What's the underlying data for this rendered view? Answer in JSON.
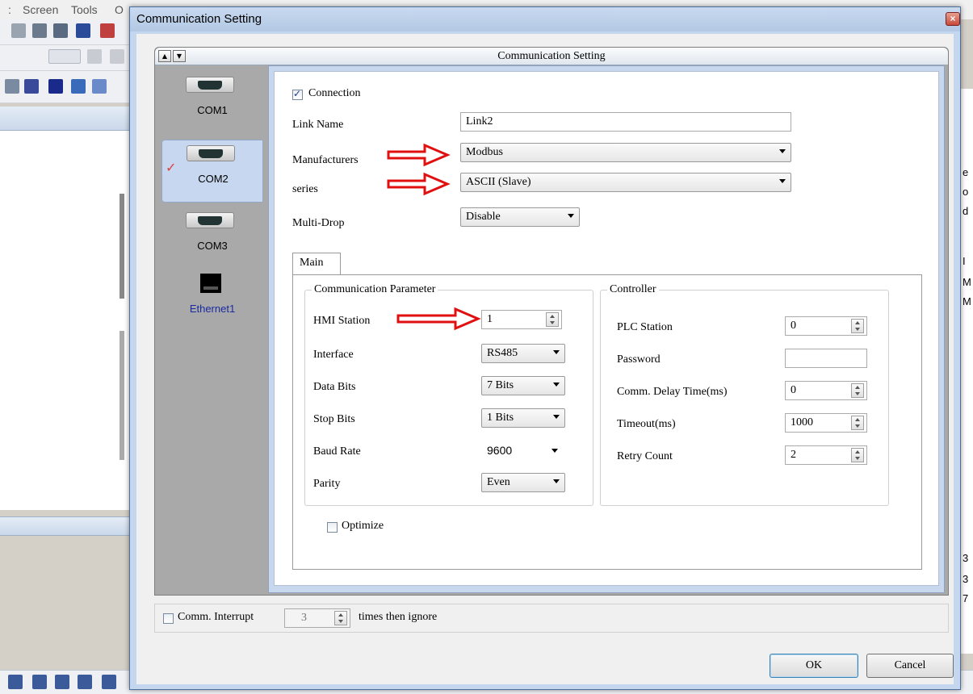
{
  "bg_app": {
    "menu_screen": "Screen",
    "menu_tools": "Tools",
    "menu_cut": "O",
    "menu_dot": ":",
    "right_strip_chars": [
      "e",
      "o",
      "d",
      "I",
      "M",
      "M",
      "3",
      "3",
      "7"
    ]
  },
  "dialog": {
    "title": "Communication Setting",
    "close_glyph": "×",
    "header_title": "Communication Setting",
    "up_glyph": "▲",
    "down_glyph": "▼"
  },
  "ports": [
    {
      "label": "COM1",
      "selected": false
    },
    {
      "label": "COM2",
      "selected": true
    },
    {
      "label": "COM3",
      "selected": false
    },
    {
      "label": "Ethernet1",
      "selected": false
    }
  ],
  "form": {
    "connection_label": "Connection",
    "connection_checked": true,
    "link_name_label": "Link Name",
    "link_name_value": "Link2",
    "manufacturers_label": "Manufacturers",
    "manufacturers_value": "Modbus",
    "series_label": "series",
    "series_value": "ASCII (Slave)",
    "multidrop_label": "Multi-Drop",
    "multidrop_value": "Disable"
  },
  "tab": {
    "main_label": "Main"
  },
  "comm_param": {
    "title": "Communication Parameter",
    "hmi_station_label": "HMI Station",
    "hmi_station_value": "1",
    "interface_label": "Interface",
    "interface_value": "RS485",
    "data_bits_label": "Data Bits",
    "data_bits_value": "7 Bits",
    "stop_bits_label": "Stop Bits",
    "stop_bits_value": "1 Bits",
    "baud_rate_label": "Baud Rate",
    "baud_rate_value": "9600",
    "parity_label": "Parity",
    "parity_value": "Even"
  },
  "controller": {
    "title": "Controller",
    "plc_station_label": "PLC Station",
    "plc_station_value": "0",
    "password_label": "Password",
    "password_value": "",
    "delay_label": "Comm. Delay Time(ms)",
    "delay_value": "0",
    "timeout_label": "Timeout(ms)",
    "timeout_value": "1000",
    "retry_label": "Retry Count",
    "retry_value": "2"
  },
  "optimize_label": "Optimize",
  "interrupt": {
    "label": "Comm. Interrupt",
    "value": "3",
    "suffix": "times then ignore"
  },
  "buttons": {
    "ok": "OK",
    "cancel": "Cancel"
  },
  "colors": {
    "annotation_arrow": "#e01010",
    "selection": "#c6d7ef"
  }
}
